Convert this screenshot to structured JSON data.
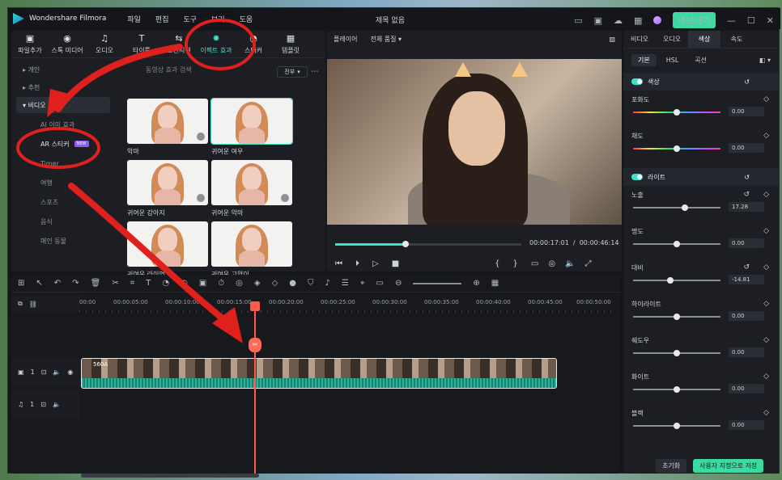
{
  "app": {
    "name": "Wondershare Filmora",
    "doc_title": "제목 없음",
    "export_label": "내보내기"
  },
  "menu": [
    "파일",
    "편집",
    "도구",
    "보기",
    "도움"
  ],
  "library": {
    "tabs": [
      {
        "label": "파일추가",
        "icon": "media-icon"
      },
      {
        "label": "스톡 미디어",
        "icon": "stock-icon"
      },
      {
        "label": "오디오",
        "icon": "music-icon"
      },
      {
        "label": "타이틀",
        "icon": "title-icon"
      },
      {
        "label": "트랜지션",
        "icon": "transition-icon"
      },
      {
        "label": "이펙트 효과",
        "icon": "effect-icon"
      },
      {
        "label": "스티커",
        "icon": "sticker-icon"
      },
      {
        "label": "템플릿",
        "icon": "template-icon"
      }
    ],
    "categories": [
      "개인",
      "추천",
      "비디오 효과"
    ],
    "subcategories": [
      "AI 이미 효과",
      "AR 스티커",
      "Timer",
      "여행",
      "스포츠",
      "음식",
      "매인 동물"
    ],
    "new_badge": "NEW",
    "search_placeholder": "동영상 효과 검색",
    "filter_label": "전부",
    "items": [
      "악마",
      "귀여운 여우",
      "귀여운 강아지",
      "귀여운 악마",
      "귀여운 라이언 2",
      "귀여운 고양이"
    ]
  },
  "player": {
    "label": "플레이어",
    "quality": "전체 품질",
    "current_time": "00:00:17:01",
    "total_time": "00:00:46:14",
    "progress": 0.38
  },
  "properties": {
    "tabs": [
      "비디오",
      "오디오",
      "색상",
      "속도"
    ],
    "subtabs": [
      "기본",
      "HSL",
      "곡선"
    ],
    "sections": [
      {
        "title": "색상",
        "rows": [
          {
            "label": "포화도",
            "value": "0.00"
          },
          {
            "label": "채도",
            "value": "0.00"
          }
        ]
      },
      {
        "title": "라이트",
        "rows": [
          {
            "label": "노출",
            "value": "17.28"
          },
          {
            "label": "명도",
            "value": "0.00"
          },
          {
            "label": "대비",
            "value": "-14.81"
          },
          {
            "label": "하이라이트",
            "value": "0.00"
          },
          {
            "label": "쉐도우",
            "value": "0.00"
          },
          {
            "label": "화이트",
            "value": "0.00"
          },
          {
            "label": "블랙",
            "value": "0.00"
          }
        ]
      }
    ],
    "reset_label": "초기화",
    "save_label": "사용자 지정으로 저장"
  },
  "timeline": {
    "ruler": [
      "00:00",
      "00:00:05:00",
      "00:00:10:00",
      "00:00:15:00",
      "00:00:20:00",
      "00:00:25:00",
      "00:00:30:00",
      "00:00:35:00",
      "00:00:40:00",
      "00:00:45:00",
      "00:00:50:00"
    ],
    "video_track": "1",
    "audio_track": "1",
    "clip_label": "560A"
  }
}
